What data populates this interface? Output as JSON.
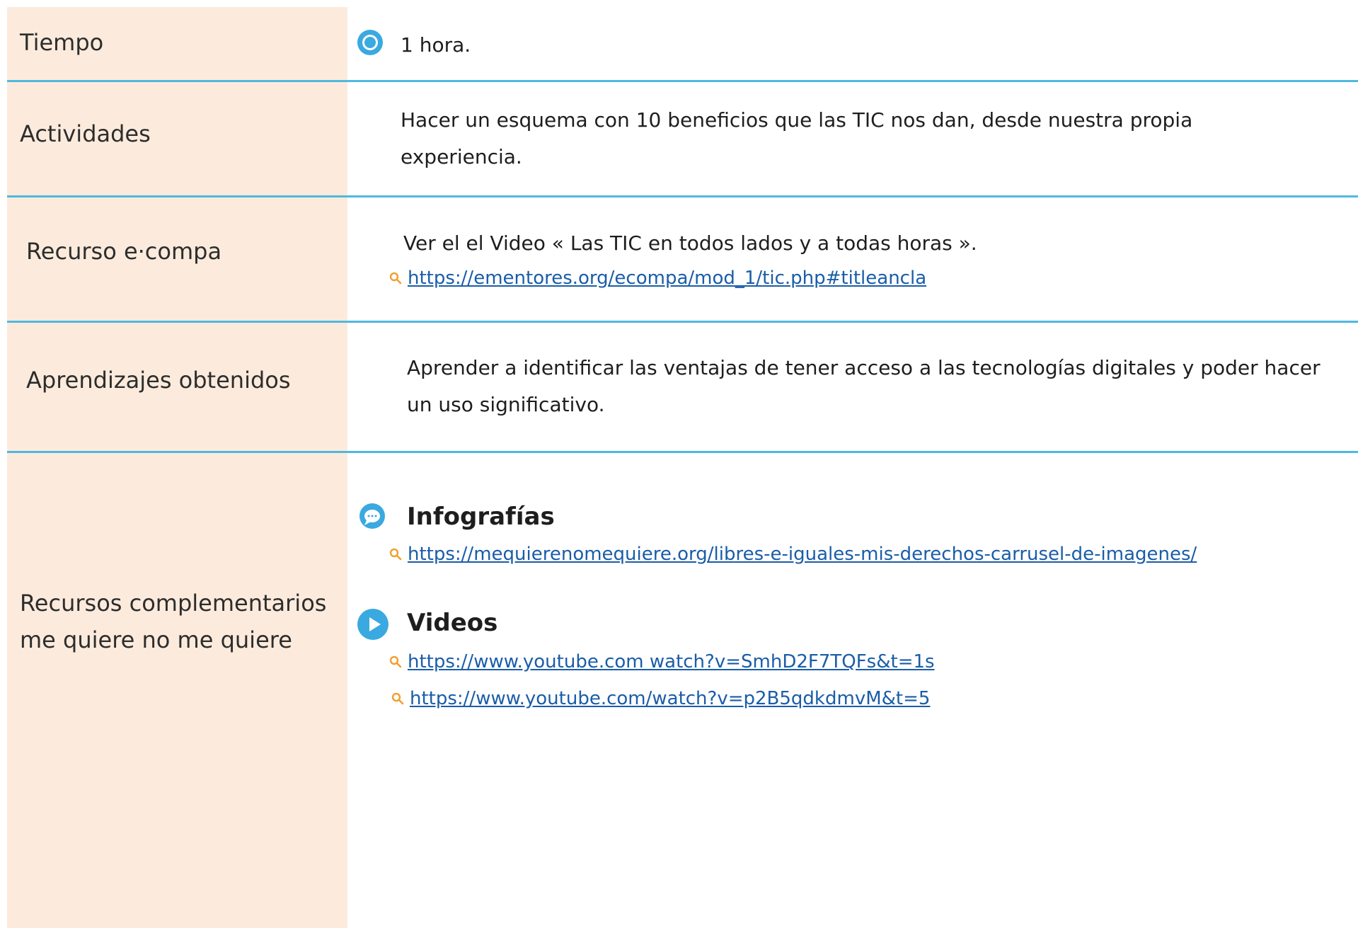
{
  "rows": {
    "tiempo": {
      "label": "Tiempo",
      "value": "1 hora."
    },
    "actividades": {
      "label": "Actividades",
      "value": "Hacer un esquema con 10 beneficios que las TIC nos dan, desde nuestra propia experiencia."
    },
    "recurso": {
      "label": "Recurso e·compa",
      "value": "Ver el el Video « Las TIC en todos lados y a todas horas ».",
      "link": "https://ementores.org/ecompa/mod_1/tic.php#titleancla"
    },
    "aprendizajes": {
      "label": "Aprendizajes obtenidos",
      "value": "Aprender a identificar las ventajas de tener acceso a las tecnologías digitales y poder hacer un uso significativo."
    },
    "complementarios": {
      "label": "Recursos complementarios me quiere no me quiere",
      "infografias_heading": "Infografías",
      "infografias_link": "https://mequierenomequiere.org/libres-e-iguales-mis-derechos-carrusel-de-imagenes/",
      "videos_heading": "Videos",
      "video_links": [
        "https://www.youtube.com watch?v=SmhD2F7TQFs&t=1s",
        "https://www.youtube.com/watch?v=p2B5qdkdmvM&t=5"
      ]
    }
  },
  "colors": {
    "label_bg": "#fcebdc",
    "divider": "#4fb8e0",
    "link": "#1a5da8",
    "icon_blue": "#3aa9e0",
    "search_orange": "#f0a030"
  },
  "icons": [
    "clock-icon",
    "search-icon",
    "chat-bubble-icon",
    "play-icon"
  ]
}
